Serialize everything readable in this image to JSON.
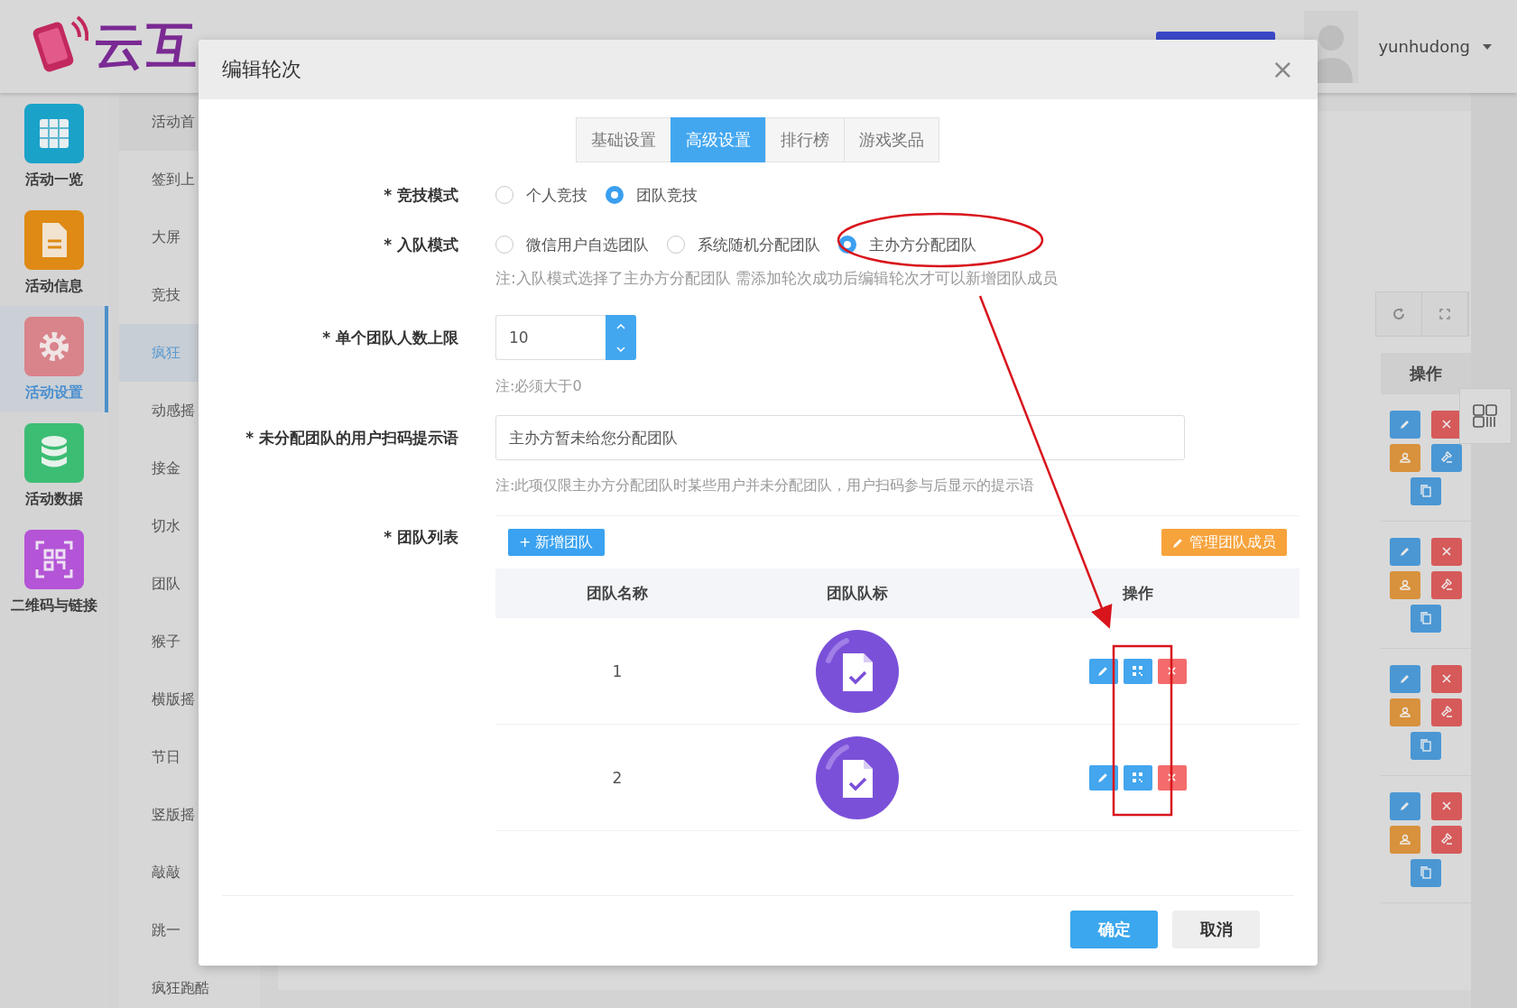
{
  "header": {
    "logo_text": "云互",
    "user": "yunhudong"
  },
  "nav_rail": [
    {
      "label": "活动一览",
      "kind": "grid",
      "color": "#1aa2c9",
      "selected": false
    },
    {
      "label": "活动信息",
      "kind": "document",
      "color": "#de8a14",
      "selected": false
    },
    {
      "label": "活动设置",
      "kind": "gear",
      "color": "#d9838b",
      "selected": true
    },
    {
      "label": "活动数据",
      "kind": "database",
      "color": "#3cbd74",
      "selected": false
    },
    {
      "label": "二维码与链接",
      "kind": "qrcode",
      "color": "#b454d6",
      "selected": false
    }
  ],
  "submenu": [
    {
      "label": "活动首",
      "selected": false
    },
    {
      "label": "签到上",
      "selected": false
    },
    {
      "label": "大屏",
      "selected": false
    },
    {
      "label": "竞技",
      "selected": false
    },
    {
      "label": "疯狂",
      "selected": true
    },
    {
      "label": "动感摇",
      "selected": false
    },
    {
      "label": "接金",
      "selected": false
    },
    {
      "label": "切水",
      "selected": false
    },
    {
      "label": "团队",
      "selected": false
    },
    {
      "label": "猴子",
      "selected": false
    },
    {
      "label": "横版摇",
      "selected": false
    },
    {
      "label": "节日",
      "selected": false
    },
    {
      "label": "竖版摇",
      "selected": false
    },
    {
      "label": "敲敲",
      "selected": false
    },
    {
      "label": "跳一",
      "selected": false
    },
    {
      "label": "疯狂跑酷",
      "selected": false
    }
  ],
  "background_table": {
    "column": "操作",
    "rows": [
      {
        "color": "#4a97d4"
      },
      {
        "color": "#d65a5a"
      },
      {
        "color": "#d65a5a"
      },
      {
        "color": "#d65a5a"
      }
    ]
  },
  "modal": {
    "title": "编辑轮次",
    "close": "×",
    "tabs": [
      {
        "label": "基础设置",
        "selected": false
      },
      {
        "label": "高级设置",
        "selected": true
      },
      {
        "label": "排行榜",
        "selected": false
      },
      {
        "label": "游戏奖品",
        "selected": false
      }
    ],
    "compete_mode": {
      "label": "* 竞技模式",
      "options": [
        {
          "label": "个人竞技",
          "selected": false
        },
        {
          "label": "团队竞技",
          "selected": true
        }
      ]
    },
    "join_mode": {
      "label": "* 入队模式",
      "options": [
        {
          "label": "微信用户自选团队",
          "selected": false
        },
        {
          "label": "系统随机分配团队",
          "selected": false
        },
        {
          "label": "主办方分配团队",
          "selected": true
        }
      ],
      "note": "注:入队模式选择了主办方分配团队 需添加轮次成功后编辑轮次才可以新增团队成员"
    },
    "team_limit": {
      "label": "* 单个团队人数上限",
      "value": "10",
      "note": "注:必须大于0"
    },
    "unassigned_tip": {
      "label": "* 未分配团队的用户扫码提示语",
      "value": "主办方暂未给您分配团队",
      "note": "注:此项仅限主办方分配团队时某些用户并未分配团队，用户扫码参与后显示的提示语"
    },
    "team_list": {
      "label": "* 团队列表",
      "add_button": "+ 新增团队",
      "manage_button": "管理团队成员",
      "columns": [
        "团队名称",
        "团队队标",
        "操作"
      ],
      "rows": [
        {
          "name": "1"
        },
        {
          "name": "2"
        }
      ]
    },
    "buttons": [
      "确定",
      "取消"
    ]
  }
}
